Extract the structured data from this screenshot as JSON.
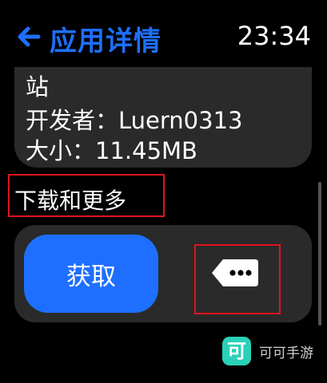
{
  "header": {
    "title": "应用详情",
    "time": "23:34",
    "back_icon": "back-arrow-icon"
  },
  "info": {
    "line1": "站",
    "developer": "开发者：Luern0313",
    "size": "大小：11.45MB"
  },
  "section": {
    "label": "下载和更多"
  },
  "actions": {
    "get_label": "获取",
    "more_icon": "more-tag-icon"
  },
  "watermark": {
    "icon_char": "可",
    "text": "可可手游"
  },
  "colors": {
    "accent": "#1e6fff",
    "highlight": "#e0141b",
    "card": "#2a2a2a",
    "watermark": "#2ad1b8"
  }
}
